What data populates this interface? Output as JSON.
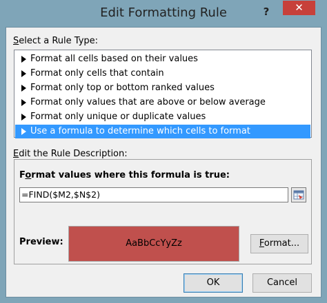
{
  "window": {
    "title": "Edit Formatting Rule",
    "help_label": "?",
    "close_label": "✕"
  },
  "rule_type": {
    "label": "Select a Rule Type:",
    "label_accel": "S",
    "label_rest": "elect a Rule Type:",
    "items": [
      {
        "label": "Format all cells based on their values",
        "selected": false
      },
      {
        "label": "Format only cells that contain",
        "selected": false
      },
      {
        "label": "Format only top or bottom ranked values",
        "selected": false
      },
      {
        "label": "Format only values that are above or below average",
        "selected": false
      },
      {
        "label": "Format only unique or duplicate values",
        "selected": false
      },
      {
        "label": "Use a formula to determine which cells to format",
        "selected": true
      }
    ]
  },
  "description": {
    "label": "Edit the Rule Description:",
    "label_accel": "E",
    "label_rest": "dit the Rule Description:",
    "formula_label": "Format values where this formula is true:",
    "formula_label_accel": "o",
    "formula_label_pre": "F",
    "formula_label_post": "rmat values where this formula is true:",
    "formula_value": "=FIND($M2,$N$2)",
    "preview_label": "Preview:",
    "preview_text": "AaBbCcYyZz",
    "preview_fill": "#c0504d",
    "format_button": "Format...",
    "format_accel": "F",
    "format_rest": "ormat..."
  },
  "footer": {
    "ok_button": "OK",
    "cancel_button": "Cancel"
  },
  "colors": {
    "selection": "#3399ff",
    "close_button": "#c7403a"
  }
}
